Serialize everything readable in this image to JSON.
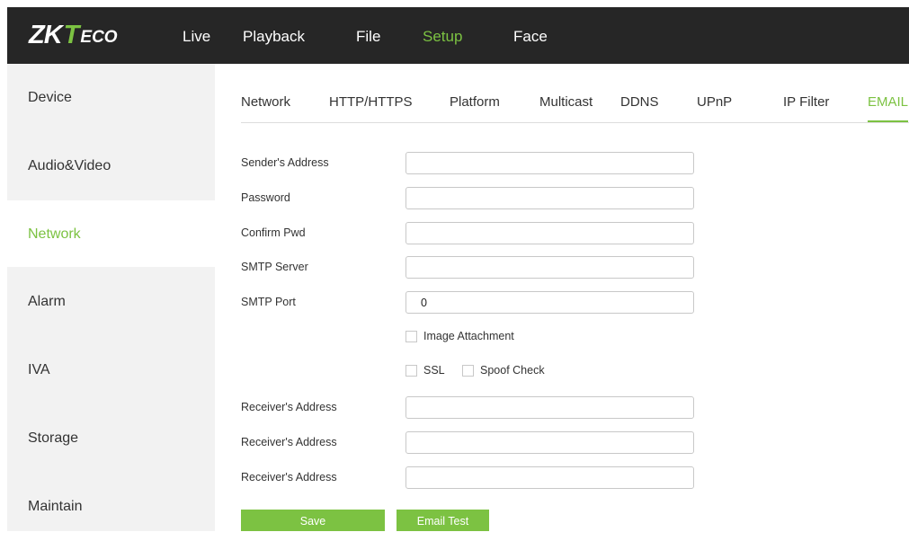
{
  "header": {
    "logo": {
      "zk": "ZK",
      "t": "T",
      "eco": "ECO"
    },
    "nav": [
      {
        "label": "Live"
      },
      {
        "label": "Playback"
      },
      {
        "label": "File"
      },
      {
        "label": "Setup",
        "active": true
      },
      {
        "label": "Face"
      }
    ]
  },
  "sidebar": {
    "items": [
      {
        "label": "Device"
      },
      {
        "label": "Audio&Video"
      },
      {
        "label": "Network",
        "active": true
      },
      {
        "label": "Alarm"
      },
      {
        "label": "IVA"
      },
      {
        "label": "Storage"
      },
      {
        "label": "Maintain"
      }
    ]
  },
  "tabs": [
    {
      "label": "Network"
    },
    {
      "label": "HTTP/HTTPS"
    },
    {
      "label": "Platform"
    },
    {
      "label": "Multicast"
    },
    {
      "label": "DDNS"
    },
    {
      "label": "UPnP"
    },
    {
      "label": "IP Filter"
    },
    {
      "label": "EMAIL",
      "active": true
    }
  ],
  "form": {
    "sender_address": {
      "label": "Sender's Address",
      "value": ""
    },
    "password": {
      "label": "Password",
      "value": ""
    },
    "confirm_pwd": {
      "label": "Confirm Pwd",
      "value": ""
    },
    "smtp_server": {
      "label": "SMTP Server",
      "value": ""
    },
    "smtp_port": {
      "label": "SMTP Port",
      "value": "0"
    },
    "image_attachment": {
      "label": "Image Attachment",
      "checked": false
    },
    "ssl": {
      "label": "SSL",
      "checked": false
    },
    "spoof_check": {
      "label": "Spoof Check",
      "checked": false
    },
    "receiver_1": {
      "label": "Receiver's Address",
      "value": ""
    },
    "receiver_2": {
      "label": "Receiver's Address",
      "value": ""
    },
    "receiver_3": {
      "label": "Receiver's Address",
      "value": ""
    }
  },
  "buttons": {
    "save": "Save",
    "email_test": "Email Test"
  },
  "colors": {
    "accent": "#7cc242",
    "header_bg": "#262626",
    "sidebar_bg": "#f2f2f2"
  }
}
